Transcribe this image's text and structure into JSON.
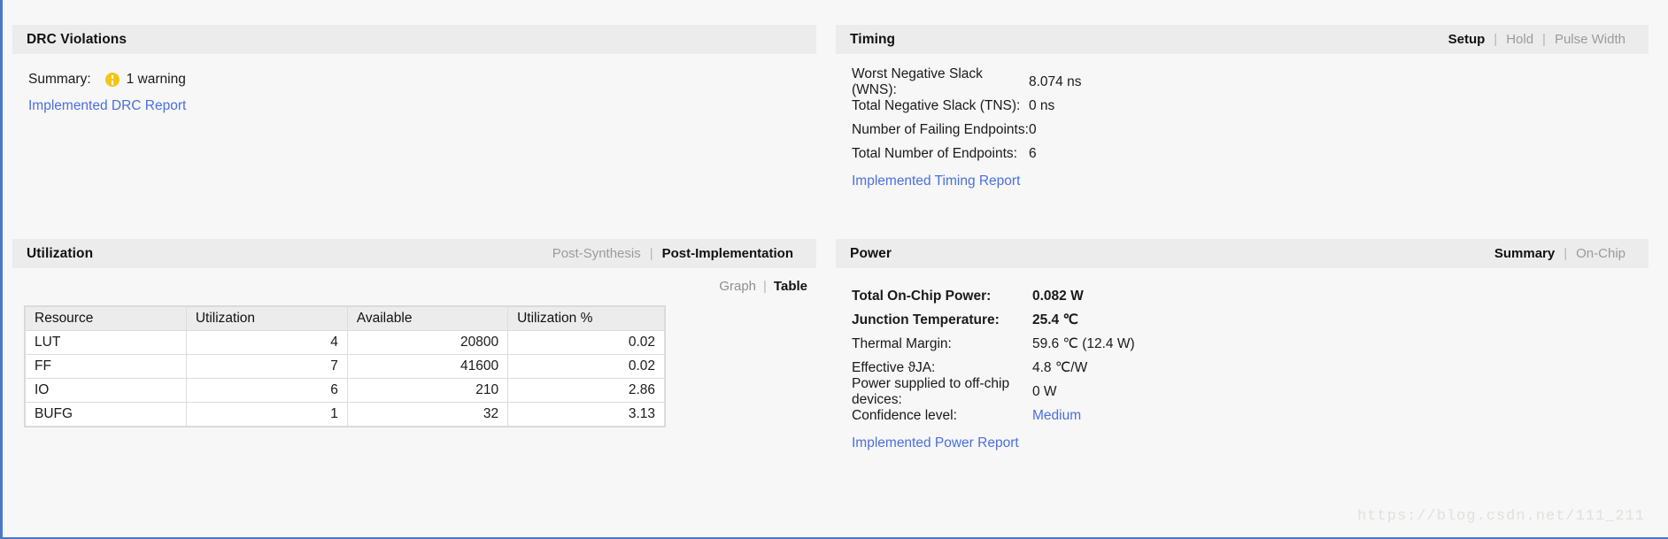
{
  "panels": {
    "drc": {
      "title": "DRC Violations",
      "summary_label": "Summary:",
      "warning_icon": "warning-icon",
      "warning_text": "1 warning",
      "report_link": "Implemented DRC Report"
    },
    "timing": {
      "title": "Timing",
      "tabs": [
        {
          "label": "Setup",
          "active": true
        },
        {
          "label": "Hold",
          "active": false
        },
        {
          "label": "Pulse Width",
          "active": false
        }
      ],
      "rows": [
        {
          "key": "Worst Negative Slack (WNS):",
          "value": "8.074 ns"
        },
        {
          "key": "Total Negative Slack (TNS):",
          "value": "0 ns"
        },
        {
          "key": "Number of Failing Endpoints:",
          "value": "0"
        },
        {
          "key": "Total Number of Endpoints:",
          "value": "6"
        }
      ],
      "report_link": "Implemented Timing Report"
    },
    "utilization": {
      "title": "Utilization",
      "tabs": [
        {
          "label": "Post-Synthesis",
          "active": false
        },
        {
          "label": "Post-Implementation",
          "active": true
        }
      ],
      "view_toggle": [
        {
          "label": "Graph",
          "active": false
        },
        {
          "label": "Table",
          "active": true
        }
      ],
      "table": {
        "columns": [
          "Resource",
          "Utilization",
          "Available",
          "Utilization %"
        ],
        "rows": [
          [
            "LUT",
            "4",
            "20800",
            "0.02"
          ],
          [
            "FF",
            "7",
            "41600",
            "0.02"
          ],
          [
            "IO",
            "6",
            "210",
            "2.86"
          ],
          [
            "BUFG",
            "1",
            "32",
            "3.13"
          ]
        ]
      }
    },
    "power": {
      "title": "Power",
      "tabs": [
        {
          "label": "Summary",
          "active": true
        },
        {
          "label": "On-Chip",
          "active": false
        }
      ],
      "rows": [
        {
          "key": "Total On-Chip Power:",
          "value": "0.082 W",
          "bold": true,
          "link": false
        },
        {
          "key": "Junction Temperature:",
          "value": "25.4 ℃",
          "bold": true,
          "link": false
        },
        {
          "key": "Thermal Margin:",
          "value": "59.6 ℃ (12.4 W)",
          "bold": false,
          "link": false
        },
        {
          "key": "Effective ϑJA:",
          "value": "4.8 ℃/W",
          "bold": false,
          "link": false
        },
        {
          "key": "Power supplied to off-chip devices:",
          "value": "0 W",
          "bold": false,
          "link": false
        },
        {
          "key": "Confidence level:",
          "value": "Medium",
          "bold": false,
          "link": true
        }
      ],
      "report_link": "Implemented Power Report"
    }
  },
  "watermark": "https://blog.csdn.net/111_211",
  "colors": {
    "link": "#4a6fe0",
    "header_bg": "#ececec",
    "warning": "#f3c518",
    "app_border": "#4c78c8"
  }
}
